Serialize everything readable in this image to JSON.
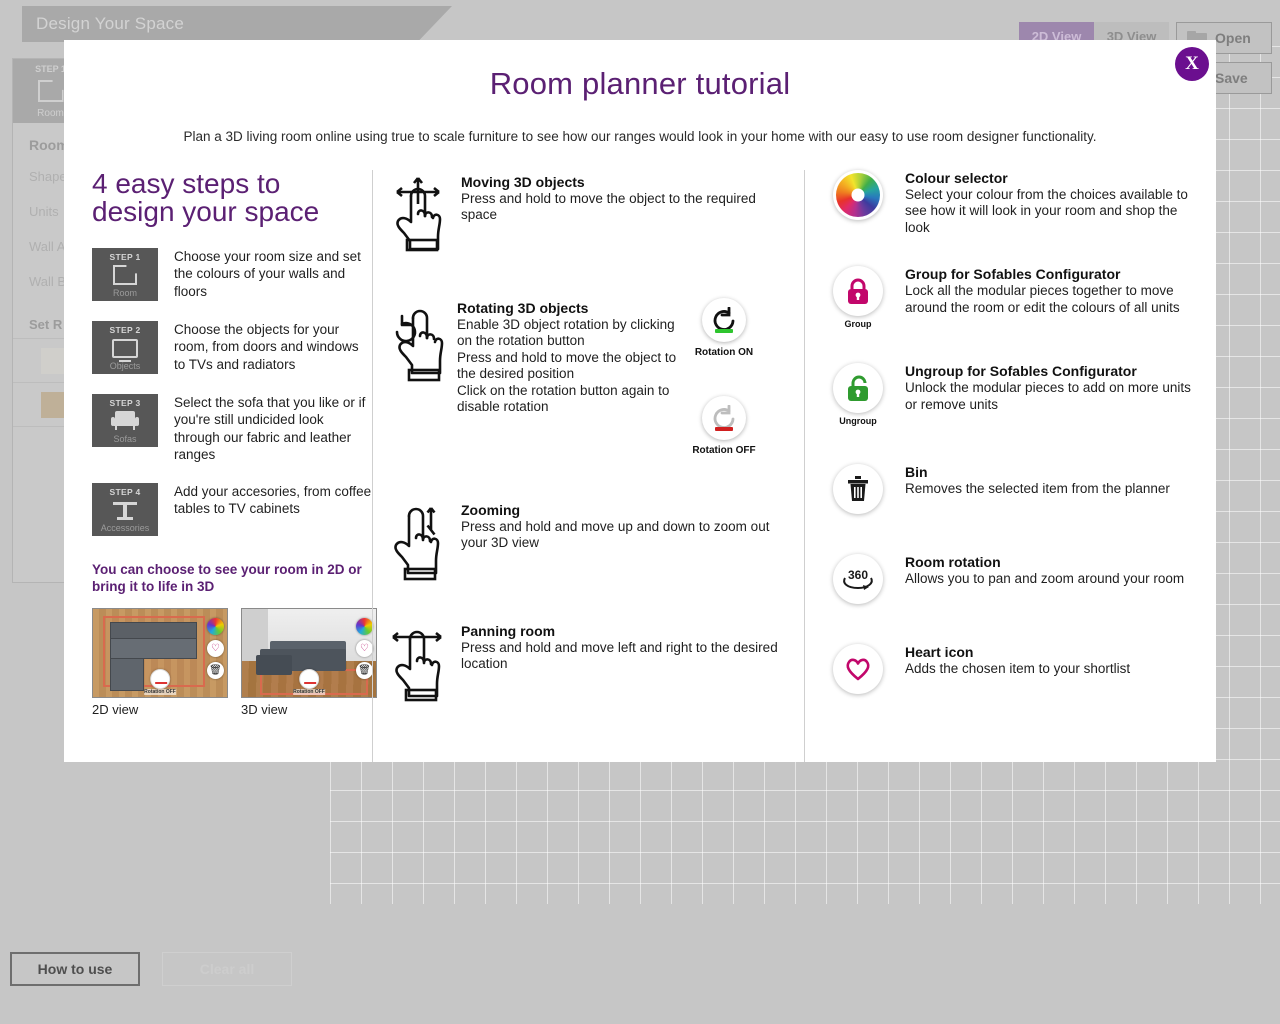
{
  "background": {
    "banner_title": "Design Your Space",
    "view_tabs": [
      {
        "label": "2D View",
        "active": true
      },
      {
        "label": "3D View",
        "active": false
      }
    ],
    "actions": [
      {
        "label": "Open",
        "icon": "folder-icon"
      },
      {
        "label": "Save",
        "icon": ""
      }
    ],
    "sidebar": {
      "step_tab": {
        "step": "STEP 1",
        "name": "Room"
      },
      "panel_title": "Room",
      "rows": [
        "Shape",
        "Units",
        "Wall A",
        "Wall B"
      ],
      "set_room_label": "Set R",
      "swatches": [
        "#d0cfcb",
        "#bfb098"
      ]
    },
    "bottom_buttons": [
      {
        "label": "How to use",
        "enabled": true
      },
      {
        "label": "Clear all",
        "enabled": false
      }
    ]
  },
  "modal": {
    "close_label": "X",
    "title": "Room planner tutorial",
    "subtitle": "Plan a 3D living room online using true to scale furniture to see how our ranges would look in your home with our easy to use room designer functionality.",
    "left": {
      "heading": "4 easy steps to design your space",
      "steps": [
        {
          "step": "STEP 1",
          "name": "Room",
          "icon": "room-icon",
          "text": "Choose your room size and set the colours of your walls and floors"
        },
        {
          "step": "STEP 2",
          "name": "Objects",
          "icon": "monitor-icon",
          "text": "Choose the objects for your room, from doors and windows to TVs and radiators"
        },
        {
          "step": "STEP 3",
          "name": "Sofas",
          "icon": "sofa-icon",
          "text": "Select the sofa that you like or if you're still undicided look through our fabric and leather ranges"
        },
        {
          "step": "STEP 4",
          "name": "Accessories",
          "icon": "accessories-icon",
          "text": "Add your accesories, from coffee tables to TV cabinets"
        }
      ],
      "views_heading": "You can choose to see your room in 2D or bring it to life in 3D",
      "views": [
        {
          "caption": "2D view",
          "rotation_badge": "Rotation OFF"
        },
        {
          "caption": "3D view",
          "rotation_badge": "Rotation OFF"
        }
      ]
    },
    "middle": {
      "gestures": [
        {
          "title": "Moving 3D objects",
          "icon": "hand-move-icon",
          "body": "Press and hold to move the object to the required space"
        },
        {
          "title": "Rotating 3D objects",
          "icon": "hand-rotate-icon",
          "body": "Enable 3D object rotation by clicking on the rotation button\nPress and hold to move the object to the desired position\nClick on the rotation button again to disable rotation"
        },
        {
          "title": "Zooming",
          "icon": "hand-zoom-icon",
          "body": "Press and hold and move up and down to zoom out your 3D view"
        },
        {
          "title": "Panning room",
          "icon": "hand-pan-icon",
          "body": "Press and hold and move left and right to the desired location"
        }
      ],
      "rotation_buttons": [
        {
          "label": "Rotation ON",
          "icon": "rotate-ccw-icon",
          "indicator_color": "#2ec52e"
        },
        {
          "label": "Rotation OFF",
          "icon": "rotate-ccw-icon",
          "indicator_color": "#d01f1f"
        }
      ]
    },
    "right": {
      "tools": [
        {
          "title": "Colour selector",
          "icon": "colour-wheel-icon",
          "sublabel": "",
          "desc": "Select your colour from the choices available to see how it will look in your room and shop the look"
        },
        {
          "title": "Group for Sofables Configurator",
          "icon": "lock-closed-icon",
          "sublabel": "Group",
          "desc": "Lock all the modular pieces together to move around the room or edit the colours of all units"
        },
        {
          "title": "Ungroup for Sofables Configurator",
          "icon": "lock-open-icon",
          "sublabel": "Ungroup",
          "desc": "Unlock the modular pieces to add on more units or remove units"
        },
        {
          "title": "Bin",
          "icon": "trash-icon",
          "sublabel": "",
          "desc": "Removes the selected item from the planner"
        },
        {
          "title": "Room rotation",
          "icon": "360-icon",
          "sublabel": "",
          "desc": "Allows you to pan and zoom around your room"
        },
        {
          "title": "Heart icon",
          "icon": "heart-icon",
          "sublabel": "",
          "desc": "Adds the chosen item to your shortlist"
        }
      ]
    }
  },
  "colors": {
    "brand_purple": "#5b2073",
    "close_purple": "#6b0f8f",
    "lock_magenta": "#c2076b",
    "unlock_green": "#2f9b2f",
    "heart_magenta": "#c2076b"
  }
}
